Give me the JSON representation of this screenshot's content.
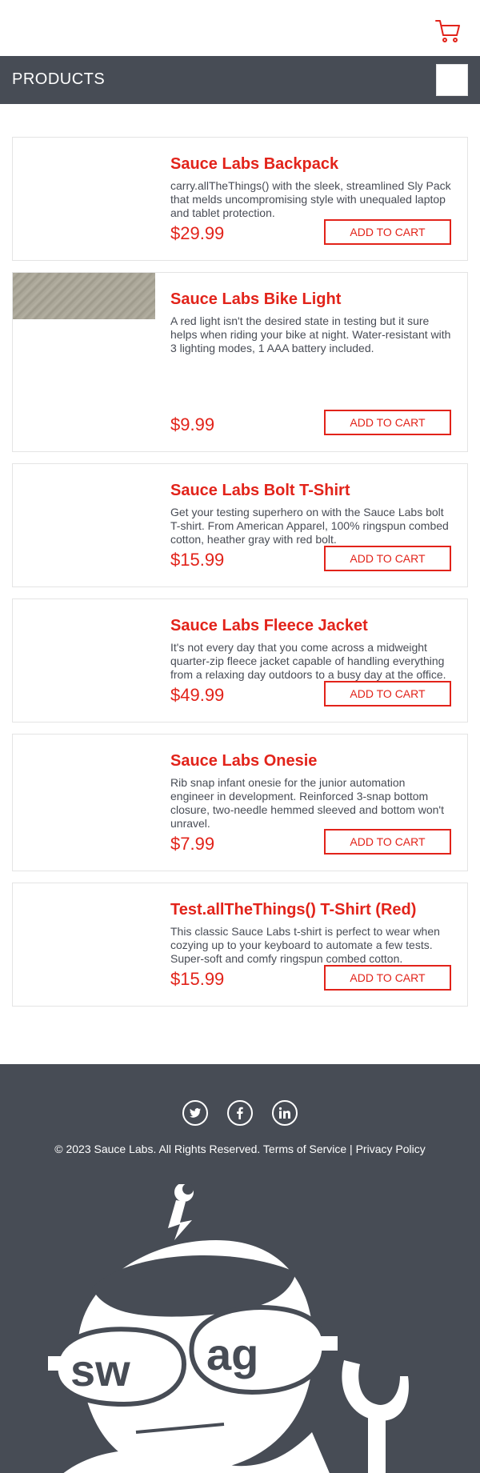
{
  "header": {
    "title": "PRODUCTS",
    "cart_icon": "shopping-cart-icon",
    "accent_color": "#e2231a",
    "bar_color": "#474c55"
  },
  "products": [
    {
      "name": "Sauce Labs Backpack",
      "description": "carry.allTheThings() with the sleek, streamlined Sly Pack that melds uncompromising style with unequaled laptop and tablet protection.",
      "price": "$29.99",
      "button": "ADD TO CART"
    },
    {
      "name": "Sauce Labs Bike Light",
      "description": "A red light isn't the desired state in testing but it sure helps when riding your bike at night. Water-resistant with 3 lighting modes, 1 AAA battery included.",
      "price": "$9.99",
      "button": "ADD TO CART"
    },
    {
      "name": "Sauce Labs Bolt T-Shirt",
      "description": "Get your testing superhero on with the Sauce Labs bolt T-shirt. From American Apparel, 100% ringspun combed cotton, heather gray with red bolt.",
      "price": "$15.99",
      "button": "ADD TO CART"
    },
    {
      "name": "Sauce Labs Fleece Jacket",
      "description": "It's not every day that you come across a midweight quarter-zip fleece jacket capable of handling everything from a relaxing day outdoors to a busy day at the office.",
      "price": "$49.99",
      "button": "ADD TO CART"
    },
    {
      "name": "Sauce Labs Onesie",
      "description": "Rib snap infant onesie for the junior automation engineer in development. Reinforced 3-snap bottom closure, two-needle hemmed sleeved and bottom won't unravel.",
      "price": "$7.99",
      "button": "ADD TO CART"
    },
    {
      "name": "Test.allTheThings() T-Shirt (Red)",
      "description": "This classic Sauce Labs t-shirt is perfect to wear when cozying up to your keyboard to automate a few tests. Super-soft and comfy ringspun combed cotton.",
      "price": "$15.99",
      "button": "ADD TO CART"
    }
  ],
  "footer": {
    "socials": [
      "twitter-icon",
      "facebook-icon",
      "linkedin-icon"
    ],
    "copyright": "© 2023 Sauce Labs. All Rights Reserved. Terms of Service | Privacy Policy",
    "mascot_text": "swag"
  }
}
